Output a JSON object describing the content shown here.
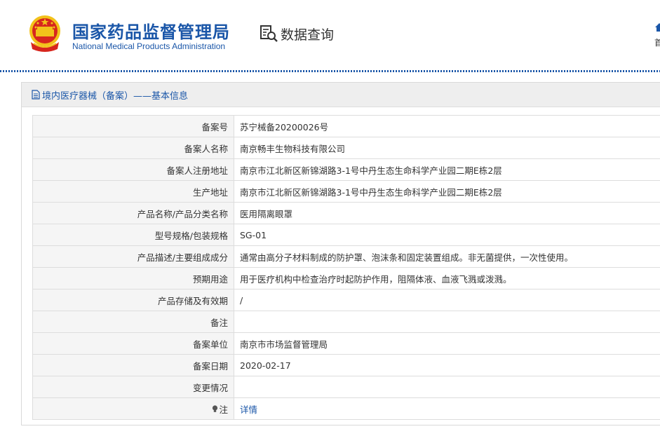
{
  "header": {
    "title_cn": "国家药品监督管理局",
    "title_en": "National Medical Products Administration",
    "query_label": "数据查询",
    "home_label": "首页"
  },
  "panel": {
    "title": "境内医疗器械（备案）——基本信息"
  },
  "rows": [
    {
      "label": "备案号",
      "value": "苏宁械备20200026号"
    },
    {
      "label": "备案人名称",
      "value": "南京畅丰生物科技有限公司"
    },
    {
      "label": "备案人注册地址",
      "value": "南京市江北新区新锦湖路3-1号中丹生态生命科学产业园二期E栋2层"
    },
    {
      "label": "生产地址",
      "value": "南京市江北新区新锦湖路3-1号中丹生态生命科学产业园二期E栋2层"
    },
    {
      "label": "产品名称/产品分类名称",
      "value": "医用隔离眼罩"
    },
    {
      "label": "型号规格/包装规格",
      "value": "SG-01"
    },
    {
      "label": "产品描述/主要组成成分",
      "value": "通常由高分子材料制成的防护罩、泡沫条和固定装置组成。非无菌提供，一次性使用。"
    },
    {
      "label": "预期用途",
      "value": "用于医疗机构中检查治疗时起防护作用，阻隔体液、血液飞溅或泼溅。"
    },
    {
      "label": "产品存储及有效期",
      "value": "/"
    },
    {
      "label": "备注",
      "value": ""
    },
    {
      "label": "备案单位",
      "value": "南京市市场监督管理局"
    },
    {
      "label": "备案日期",
      "value": "2020-02-17"
    },
    {
      "label": "变更情况",
      "value": ""
    }
  ],
  "note_row": {
    "label": "注",
    "link": "详情"
  },
  "colors": {
    "brand_blue": "#1a56a8",
    "emblem_red": "#d7261e",
    "emblem_gold": "#f2c21a"
  },
  "icons": [
    "national-emblem-icon",
    "magnifier-document-icon",
    "home-icon",
    "document-icon",
    "lightbulb-icon"
  ]
}
